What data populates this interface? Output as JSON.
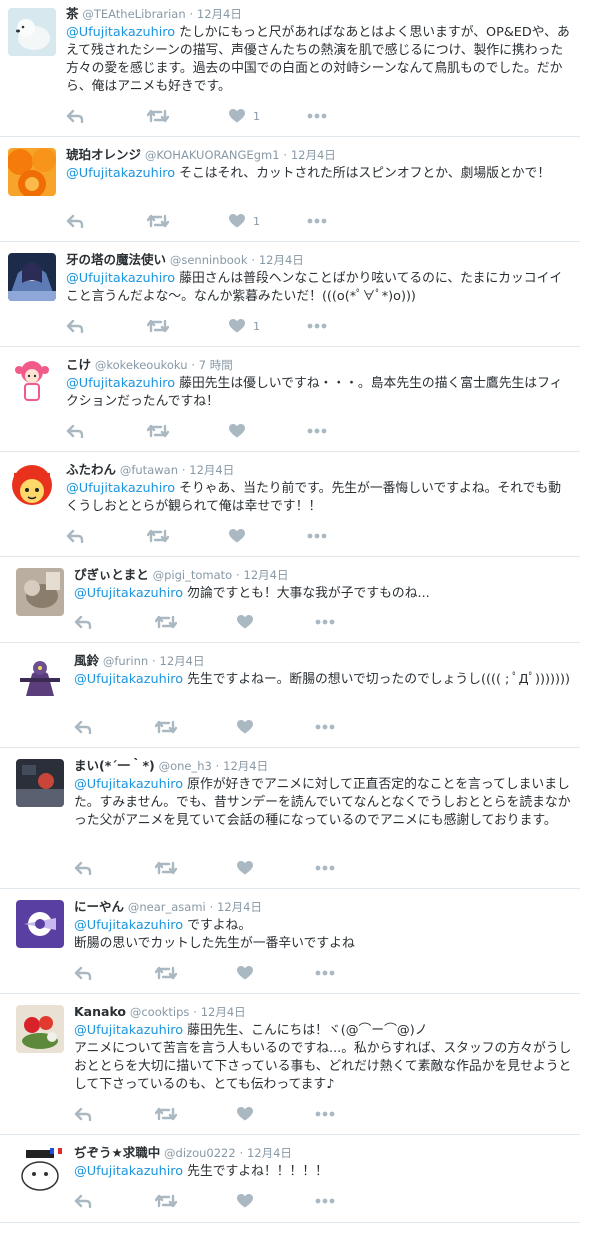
{
  "tweets": [
    {
      "name": "茶",
      "handle": "@TEAtheLibrarian",
      "time": "12月4日",
      "mention": "@Ufujitakazuhiro",
      "text": " たしかにもっと尺があればなあとはよく思いますが、OP&EDや、あえて残されたシーンの描写、声優さんたちの熱演を肌で感じるにつけ、製作に携わった方々の愛を感じます。過去の中国での白面との対峙シーンなんて鳥肌ものでした。だから、俺はアニメも好きです。",
      "likes": "1"
    },
    {
      "name": "琥珀オレンジ",
      "handle": "@KOHAKUORANGEgm1",
      "time": "12月4日",
      "mention": "@Ufujitakazuhiro",
      "text": " そこはそれ、カットされた所はスピンオフとか、劇場版とかで！",
      "likes": "1"
    },
    {
      "name": "牙の塔の魔法使い",
      "handle": "@senninbook",
      "time": "12月4日",
      "mention": "@Ufujitakazuhiro",
      "text": " 藤田さんは普段ヘンなことばかり呟いてるのに、たまにカッコイイこと言うんだよな〜。なんか紫暮みたいだ！(((o(*ﾟ∀ﾟ*)o)))",
      "likes": "1"
    },
    {
      "name": "こけ",
      "handle": "@kokekeoukoku",
      "time": "7 時間",
      "mention": "@Ufujitakazuhiro",
      "text": " 藤田先生は優しいですね・・・。島本先生の描く富士鷹先生はフィクションだったんですね！",
      "likes": ""
    },
    {
      "name": "ふたわん",
      "handle": "@futawan",
      "time": "12月4日",
      "mention": "@Ufujitakazuhiro",
      "text": " そりゃあ、当たり前です。先生が一番悔しいですよね。それでも動くうしおととらが観られて俺は幸せです！！",
      "likes": ""
    },
    {
      "name": "ぴぎぃとまと",
      "handle": "@pigi_tomato",
      "time": "12月4日",
      "mention": "@Ufujitakazuhiro",
      "text": " 勿論ですとも！大事な我が子ですものね...",
      "likes": ""
    },
    {
      "name": "風鈴",
      "handle": "@furinn",
      "time": "12月4日",
      "mention": "@Ufujitakazuhiro",
      "text": " 先生ですよねー。断腸の想いで切ったのでしょうし(((( ; ﾟДﾟ)))))))",
      "likes": ""
    },
    {
      "name": "まい(*´一｀*)",
      "handle": "@one_h3",
      "time": "12月4日",
      "mention": "@Ufujitakazuhiro",
      "text": " 原作が好きでアニメに対して正直否定的なことを言ってしまいました。すみません。でも、昔サンデーを読んでいてなんとなくでうしおととらを読まなかった父がアニメを見ていて会話の種になっているのでアニメにも感謝しております。",
      "likes": ""
    },
    {
      "name": "にーやん",
      "handle": "@near_asami",
      "time": "12月4日",
      "mention": "@Ufujitakazuhiro",
      "text": " ですよね。\n断腸の思いでカットした先生が一番辛いですよね",
      "likes": ""
    },
    {
      "name": "Kanako",
      "handle": "@cooktips",
      "time": "12月4日",
      "mention": "@Ufujitakazuhiro",
      "text": " 藤田先生、こんにちは！ヾ(@⌒ー⌒@)ノ\nアニメについて苦言を言う人もいるのですね...。私からすれば、スタッフの方々がうしおととらを大切に描いて下さっている事も、どれだけ熱くて素敵な作品かを見せようとして下さっているのも、とても伝わってます♪",
      "likes": ""
    },
    {
      "name": "ぢぞう★求職中",
      "handle": "@dizou0222",
      "time": "12月4日",
      "mention": "@Ufujitakazuhiro",
      "text": " 先生ですよね！！！！！",
      "likes": ""
    }
  ],
  "colors": {
    "mention": "#1b95e0",
    "meta": "#8899a6",
    "icon": "#aab8c2",
    "border": "#e1e8ed"
  }
}
